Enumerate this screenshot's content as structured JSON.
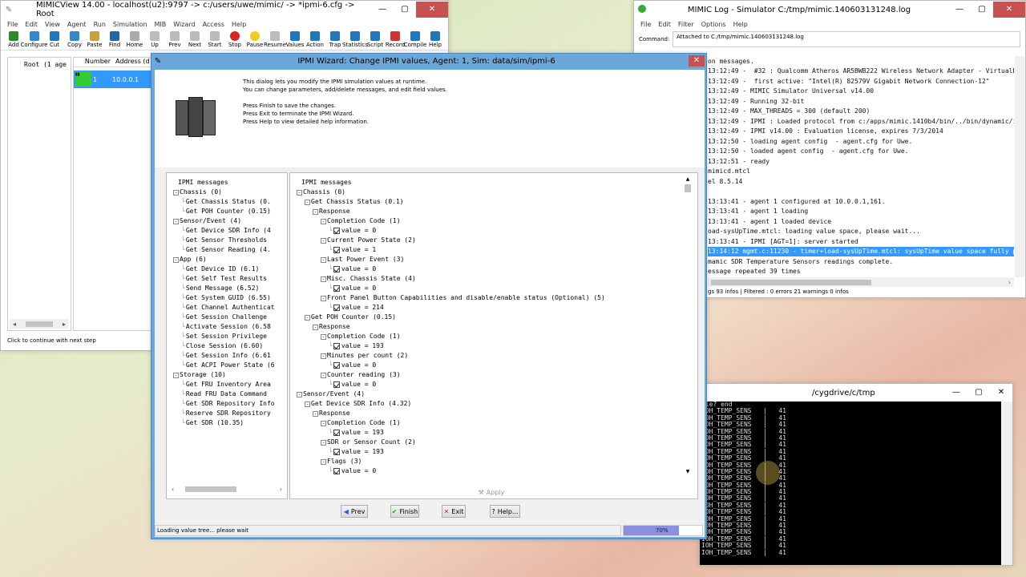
{
  "mimicview": {
    "title": "MIMICView 14.00 - localhost(u2):9797 -> c:/users/uwe/mimic/ -> *ipmi-6.cfg -> Root",
    "menu": [
      "File",
      "Edit",
      "View",
      "Agent",
      "Run",
      "Simulation",
      "MIB",
      "Wizard",
      "Access",
      "Help"
    ],
    "toolbar": [
      "Add",
      "Configure",
      "Cut",
      "Copy",
      "Paste",
      "Find",
      "Home",
      "Up",
      "Prev",
      "Next",
      "Start",
      "Stop",
      "Pause",
      "Resume",
      "Values",
      "Action",
      "Trap",
      "Statistics",
      "Script",
      "Record",
      "Compile",
      "Help"
    ],
    "tree_root": "Root (1 age",
    "col_number": "Number",
    "col_address": "Address (d",
    "row_number": "1",
    "row_address": "10.0.0.1",
    "status": "Click to continue with next step"
  },
  "log": {
    "title": "MIMIC Log - Simulator C:/tmp/mimic.140603131248.log",
    "menu": [
      "File",
      "Edit",
      "Filter",
      "Options",
      "Help"
    ],
    "command_label": "Command:",
    "command_value": "Attached to C:/tmp/mimic.140603131248.log",
    "lines": [
      "on messages.",
      "13:12:49 -  #32 : Qualcomm Atheros AR5BWB222 Wireless Network Adapter - VirtualBo",
      "13:12:49 -  first active: \"Intel(R) 82579V Gigabit Network Connection-12\"",
      "13:12:49 - MIMIC Simulator Universal v14.00",
      "13:12:49 - Running 32-bit",
      "13:12:49 - MAX_THREADS = 300 (default 200)",
      "13:12:49 - IPMI : Loaded protocol from c:/apps/mimic.1410b4/bin/../bin/dynamic/ip",
      "13:12:49 - IPMI v14.00 : Evaluation license, expires 7/3/2014",
      "13:12:50 - loading agent config  - agent.cfg for Uwe.",
      "13:12:50 - loaded agent config  - agent.cfg for Uwe.",
      "13:12:51 - ready",
      "mimicd.mtcl",
      "el 8.5.14",
      "",
      "13:13:41 - agent 1 configured at 10.0.0.1,161.",
      "13:13:41 - agent 1 loading",
      "13:13:41 - agent 1 loaded device",
      "oad-sysUpTime.mtcl: loading value space, please wait...",
      "13:13:41 - IPMI [AGT=1]: server started",
      "13:14:12 mgmt.c:11230 - timer+load-sysUpTime.mtcl: sysUpTime value space fully p",
      "mamic SDR Temperature Sensors readings complete.",
      "essage repeated 39 times"
    ],
    "status": "gs 93 infos  |  Filtered : 0 errors 21 warnings 0 infos"
  },
  "wizard": {
    "title": "IPMI Wizard: Change IPMI values, Agent: 1, Sim: data/sim/ipmi-6",
    "intro": [
      "This dialog lets you modify the IPMI simulation values at runtime.",
      "You can change parameters, add/delete messages, and edit field values.",
      "",
      "Press Finish to save the changes.",
      "Press Exit to terminate the IPMI Wizard.",
      "Press Help to view detailed help information."
    ],
    "left_tree": [
      {
        "t": "IPMI messages",
        "d": 0,
        "e": ""
      },
      {
        "t": "Chassis (0)",
        "d": 1,
        "e": "-"
      },
      {
        "t": "Get Chassis Status (0.",
        "d": 2,
        "e": ""
      },
      {
        "t": "Get POH Counter (0.15)",
        "d": 2,
        "e": ""
      },
      {
        "t": "Sensor/Event (4)",
        "d": 1,
        "e": "-"
      },
      {
        "t": "Get Device SDR Info (4",
        "d": 2,
        "e": ""
      },
      {
        "t": "Get Sensor Thresholds",
        "d": 2,
        "e": ""
      },
      {
        "t": "Get Sensor Reading (4.",
        "d": 2,
        "e": ""
      },
      {
        "t": "App (6)",
        "d": 1,
        "e": "-"
      },
      {
        "t": "Get Device ID (6.1)",
        "d": 2,
        "e": ""
      },
      {
        "t": "Get Self Test Results",
        "d": 2,
        "e": ""
      },
      {
        "t": "Send Message (6.52)",
        "d": 2,
        "e": ""
      },
      {
        "t": "Get System GUID (6.55)",
        "d": 2,
        "e": ""
      },
      {
        "t": "Get Channel Authenticat",
        "d": 2,
        "e": ""
      },
      {
        "t": "Get Session Challenge",
        "d": 2,
        "e": ""
      },
      {
        "t": "Activate Session (6.58",
        "d": 2,
        "e": ""
      },
      {
        "t": "Set Session Privilege",
        "d": 2,
        "e": ""
      },
      {
        "t": "Close Session (6.60)",
        "d": 2,
        "e": ""
      },
      {
        "t": "Get Session Info (6.61",
        "d": 2,
        "e": ""
      },
      {
        "t": "Get ACPI Power State (6",
        "d": 2,
        "e": ""
      },
      {
        "t": "Storage (10)",
        "d": 1,
        "e": "-"
      },
      {
        "t": "Get FRU Inventory Area",
        "d": 2,
        "e": ""
      },
      {
        "t": "Read FRU Data Command",
        "d": 2,
        "e": ""
      },
      {
        "t": "Get SDR Repository Info",
        "d": 2,
        "e": ""
      },
      {
        "t": "Reserve SDR Repository",
        "d": 2,
        "e": ""
      },
      {
        "t": "Get SDR (10.35)",
        "d": 2,
        "e": ""
      }
    ],
    "right_tree": [
      {
        "t": "IPMI messages",
        "d": 0,
        "e": "",
        "c": false
      },
      {
        "t": "Chassis (0)",
        "d": 1,
        "e": "-",
        "c": false
      },
      {
        "t": "Get Chassis Status (0.1)",
        "d": 2,
        "e": "-",
        "c": false
      },
      {
        "t": "Response",
        "d": 3,
        "e": "-",
        "c": false
      },
      {
        "t": "Completion Code (1)",
        "d": 4,
        "e": "-",
        "c": false
      },
      {
        "t": "value = 0",
        "d": 5,
        "e": "",
        "c": true
      },
      {
        "t": "Current Power State (2)",
        "d": 4,
        "e": "-",
        "c": false
      },
      {
        "t": "value = 1",
        "d": 5,
        "e": "",
        "c": true
      },
      {
        "t": "Last Power Event (3)",
        "d": 4,
        "e": "-",
        "c": false
      },
      {
        "t": "value = 0",
        "d": 5,
        "e": "",
        "c": true
      },
      {
        "t": "Misc. Chassis State (4)",
        "d": 4,
        "e": "-",
        "c": false
      },
      {
        "t": "value = 0",
        "d": 5,
        "e": "",
        "c": true
      },
      {
        "t": "Front Panel Button Capabilities and disable/enable status (Optional) (5)",
        "d": 4,
        "e": "-",
        "c": false
      },
      {
        "t": "value = 214",
        "d": 5,
        "e": "",
        "c": true
      },
      {
        "t": "Get POH Counter (0.15)",
        "d": 2,
        "e": "-",
        "c": false
      },
      {
        "t": "Response",
        "d": 3,
        "e": "-",
        "c": false
      },
      {
        "t": "Completion Code (1)",
        "d": 4,
        "e": "-",
        "c": false
      },
      {
        "t": "value = 193",
        "d": 5,
        "e": "",
        "c": true
      },
      {
        "t": "Minutes per count (2)",
        "d": 4,
        "e": "-",
        "c": false
      },
      {
        "t": "value = 0",
        "d": 5,
        "e": "",
        "c": true
      },
      {
        "t": "Counter reading (3)",
        "d": 4,
        "e": "-",
        "c": false
      },
      {
        "t": "value = 0",
        "d": 5,
        "e": "",
        "c": true
      },
      {
        "t": "Sensor/Event (4)",
        "d": 1,
        "e": "-",
        "c": false
      },
      {
        "t": "Get Device SDR Info (4.32)",
        "d": 2,
        "e": "-",
        "c": false
      },
      {
        "t": "Response",
        "d": 3,
        "e": "-",
        "c": false
      },
      {
        "t": "Completion Code (1)",
        "d": 4,
        "e": "-",
        "c": false
      },
      {
        "t": "value = 193",
        "d": 5,
        "e": "",
        "c": true
      },
      {
        "t": "SDR or Sensor Count (2)",
        "d": 4,
        "e": "-",
        "c": false
      },
      {
        "t": "value = 193",
        "d": 5,
        "e": "",
        "c": true
      },
      {
        "t": "Flags (3)",
        "d": 4,
        "e": "-",
        "c": false
      },
      {
        "t": "value = 0",
        "d": 5,
        "e": "",
        "c": true
      }
    ],
    "apply": "Apply",
    "prev": "Prev",
    "finish": "Finish",
    "exit": "Exit",
    "help": "Help...",
    "status": "Loading value tree... please wait",
    "progress_text": "70%",
    "progress": 0.7
  },
  "terminal": {
    "title": "/cygdrive/c/tmp",
    "first": "nle? end",
    "sens": "IOH_TEMP_SENS",
    "val": "41",
    "count": 22
  },
  "colors": {
    "accent": "#3399ff",
    "progress": "#8a8fe0"
  }
}
